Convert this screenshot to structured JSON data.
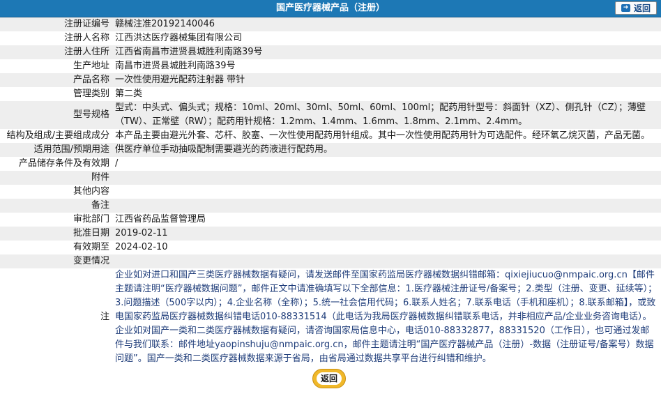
{
  "header": {
    "title": "国产医疗器械产品（注册）",
    "back_label": "返回"
  },
  "rows": [
    {
      "label": "注册证编号",
      "value": "赣械注准20192140046"
    },
    {
      "label": "注册人名称",
      "value": "江西洪达医疗器械集团有限公司"
    },
    {
      "label": "注册人住所",
      "value": "江西省南昌市进贤县城胜利南路39号"
    },
    {
      "label": "生产地址",
      "value": "南昌市进贤县城胜利南路39号"
    },
    {
      "label": "产品名称",
      "value": "一次性使用避光配药注射器 带针"
    },
    {
      "label": "管理类别",
      "value": "第二类"
    },
    {
      "label": "型号规格",
      "value": "型式：中头式、偏头式；规格：10ml、20ml、30ml、50ml、60ml、100ml；配药用针型号：斜面针（XZ）、侧孔针（CZ）；薄壁（TW）、正常壁（RW）；配药用针规格：1.2mm、1.4mm、1.6mm、1.8mm、2.1mm、2.4mm。"
    },
    {
      "label": "结构及组成/主要组成成分",
      "value": "本产品主要由避光外套、芯杆、胶塞、一次性使用配药用针组成。其中一次性使用配药用针为可选配件。经环氧乙烷灭菌，产品无菌。"
    },
    {
      "label": "适用范围/预期用途",
      "value": "供医疗单位手动抽吸配制需要避光的药液进行配药用。"
    },
    {
      "label": "产品储存条件及有效期",
      "value": "/"
    },
    {
      "label": "附件",
      "value": ""
    },
    {
      "label": "其他内容",
      "value": ""
    },
    {
      "label": "备注",
      "value": ""
    },
    {
      "label": "审批部门",
      "value": "江西省药品监督管理局"
    },
    {
      "label": "批准日期",
      "value": "2019-02-11"
    },
    {
      "label": "有效期至",
      "value": "2024-02-10"
    },
    {
      "label": "变更情况",
      "value": ""
    }
  ],
  "note": {
    "label": "注",
    "text": "企业如对进口和国产三类医疗器械数据有疑问，请发送邮件至国家药监局医疗器械数据纠错邮箱：qixiejiucuo@nmpaic.org.cn【邮件主题请注明“医疗器械数据问题”，邮件正文中请准确填写以下全部信息：1.医疗器械注册证号/备案号；2.类型（注册、变更、延续等）；3.问题描述（500字以内）；4.企业名称（全称）；5.统一社会信用代码；6.联系人姓名；7.联系电话（手机和座机）；8.联系邮箱】，或致电国家药监局医疗器械数据纠错电话010-88331514（此电话为我局医疗器械数据纠错联系电话，并非相应产品/企业业务咨询电话）。企业如对国产一类和二类医疗器械数据有疑问，请咨询国家局信息中心，电话010-88332877，88331520（工作日），也可通过发邮件与我们联系：邮件地址yaopinshuju@nmpaic.org.cn，邮件主题请注明“国产医疗器械产品（注册）-数据（注册证号/备案号）数据问题”。国产一类和二类医疗器械数据来源于省局，由省局通过数据共享平台进行纠错和维护。"
  },
  "footer": {
    "back_label": "返回"
  }
}
